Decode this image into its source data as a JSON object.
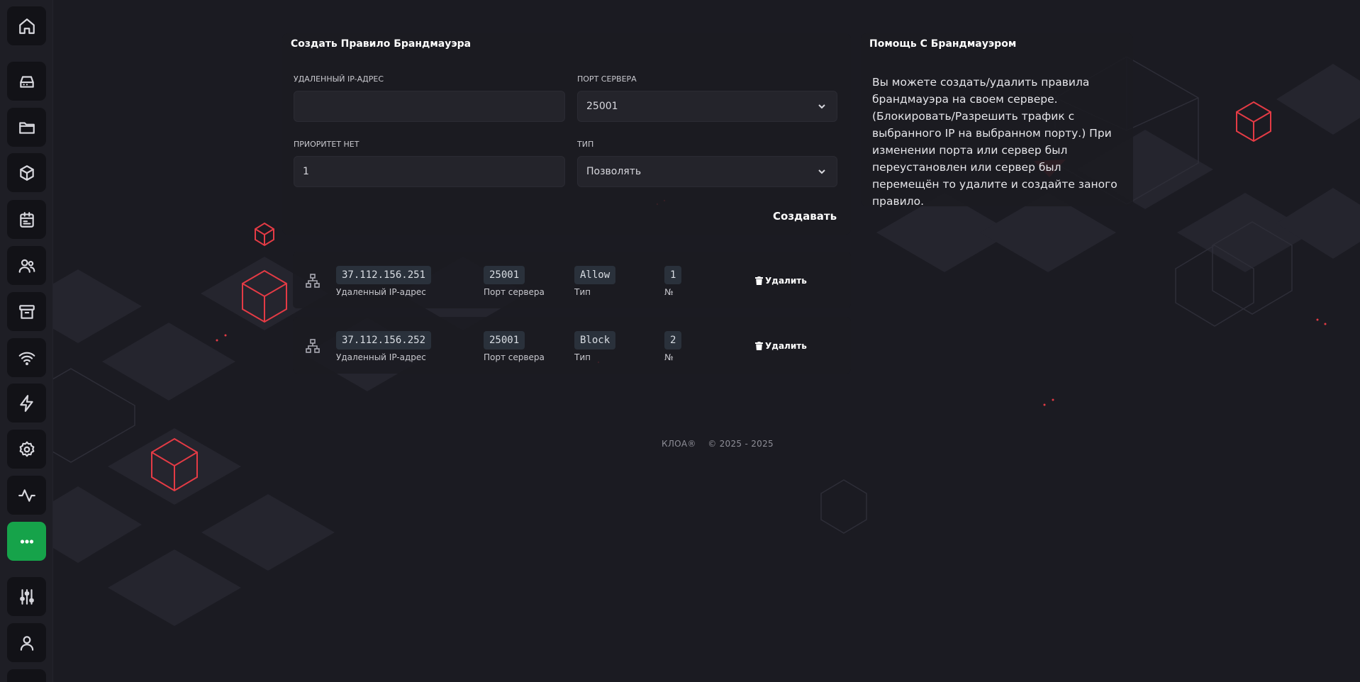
{
  "sidebar": {
    "items": [
      {
        "name": "home",
        "icon": "home-icon"
      },
      {
        "name": "storage",
        "icon": "hard-drive-icon"
      },
      {
        "name": "files",
        "icon": "folder-icon"
      },
      {
        "name": "packages",
        "icon": "cube-icon"
      },
      {
        "name": "schedules",
        "icon": "calendar-icon"
      },
      {
        "name": "users",
        "icon": "users-icon"
      },
      {
        "name": "backups",
        "icon": "archive-icon"
      },
      {
        "name": "network",
        "icon": "wifi-icon"
      },
      {
        "name": "startup",
        "icon": "lightning-icon"
      },
      {
        "name": "settings",
        "icon": "gear-icon"
      },
      {
        "name": "activity",
        "icon": "activity-icon"
      },
      {
        "name": "more",
        "icon": "dots-icon",
        "active": true
      },
      {
        "name": "admin",
        "icon": "sliders-icon"
      },
      {
        "name": "account",
        "icon": "user-icon"
      }
    ],
    "active_color": "#16a34a"
  },
  "create_rule": {
    "title": "Создать Правило Брандмауэра",
    "remote_ip_label": "Удаленный IP-адрес",
    "remote_ip_value": "",
    "server_port_label": "Порт сервера",
    "server_port_value": "25001",
    "priority_label": "Приоритет нет",
    "priority_value": "1",
    "type_label": "Тип",
    "type_value": "Позволять",
    "submit_label": "Создавать"
  },
  "rules": [
    {
      "ip": "37.112.156.251",
      "ip_label": "Удаленный IP-адрес",
      "port": "25001",
      "port_label": "Порт сервера",
      "type": "Allow",
      "type_label": "Тип",
      "number": "1",
      "number_label": "№",
      "delete_label": "Удалить"
    },
    {
      "ip": "37.112.156.252",
      "ip_label": "Удаленный IP-адрес",
      "port": "25001",
      "port_label": "Порт сервера",
      "type": "Block",
      "type_label": "Тип",
      "number": "2",
      "number_label": "№",
      "delete_label": "Удалить"
    }
  ],
  "help": {
    "title": "Помощь С Брандмауэром",
    "text": "Вы можете создать/удалить правила брандмауэра на своем сервере. (Блокировать/Разрешить трафик с выбранного IP на выбранном порту.) При изменении порта или сервер был переустановлен или сервер был перемещён то удалите и создайте заного правило."
  },
  "footer": {
    "brand": "КЛОА®",
    "copyright": "© 2025 - 2025"
  }
}
